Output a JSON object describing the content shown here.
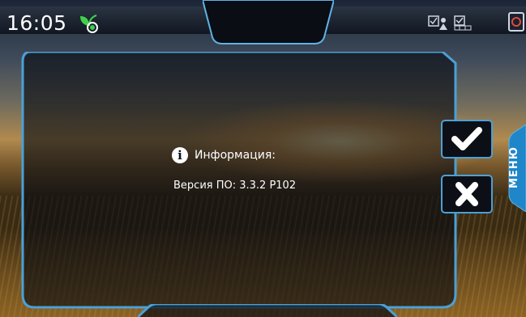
{
  "status_bar": {
    "time": "16:05",
    "icons": [
      "gps-leaf-icon",
      "person-checklist-icon",
      "grid-checklist-icon",
      "corner-settings-icon"
    ]
  },
  "dialog": {
    "title": "Информация:",
    "message": "Версия ПО: 3.3.2 P102",
    "confirm_icon": "checkmark-icon",
    "cancel_icon": "x-icon"
  },
  "side_menu": {
    "label": "МЕНЮ"
  },
  "colors": {
    "accent": "#4ba0d6",
    "panel": "#0b0f18",
    "text": "#ffffff",
    "gps_green": "#3fd14a"
  }
}
